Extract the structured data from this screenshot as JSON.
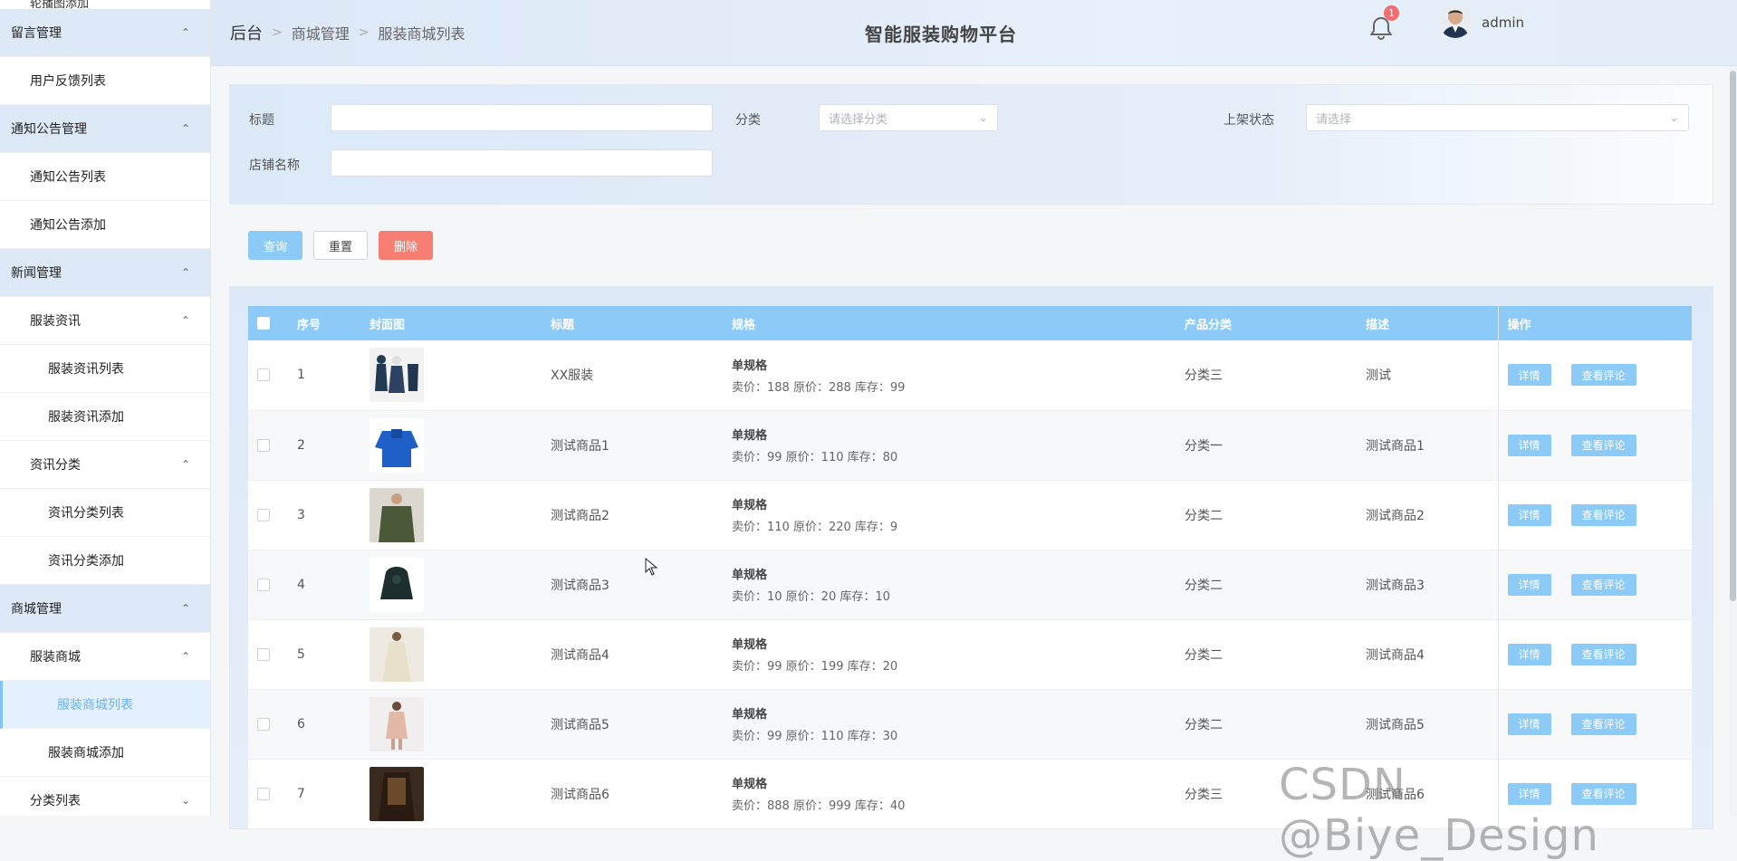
{
  "sidebar": {
    "clipped_item": "轮播图添加",
    "items": [
      {
        "label": "留言管理",
        "level": 0,
        "group": true
      },
      {
        "label": "用户反馈列表",
        "level": 1
      },
      {
        "label": "通知公告管理",
        "level": 0,
        "group": true
      },
      {
        "label": "通知公告列表",
        "level": 1
      },
      {
        "label": "通知公告添加",
        "level": 1
      },
      {
        "label": "新闻管理",
        "level": 0,
        "group": true
      },
      {
        "label": "服装资讯",
        "level": 1,
        "chevron": true
      },
      {
        "label": "服装资讯列表",
        "level": 2
      },
      {
        "label": "服装资讯添加",
        "level": 2
      },
      {
        "label": "资讯分类",
        "level": 1,
        "chevron": true
      },
      {
        "label": "资讯分类列表",
        "level": 2
      },
      {
        "label": "资讯分类添加",
        "level": 2
      },
      {
        "label": "商城管理",
        "level": 0,
        "group": true
      },
      {
        "label": "服装商城",
        "level": 1,
        "chevron": true
      },
      {
        "label": "服装商城列表",
        "level": 2,
        "active": true
      },
      {
        "label": "服装商城添加",
        "level": 2
      },
      {
        "label": "分类列表",
        "level": 1,
        "chevron": true
      }
    ]
  },
  "header": {
    "breadcrumb": [
      "后台",
      "商城管理",
      "服装商城列表"
    ],
    "app_title": "智能服装购物平台",
    "notification_count": "1",
    "username": "admin"
  },
  "filters": {
    "title_label": "标题",
    "title_value": "",
    "category_label": "分类",
    "category_placeholder": "请选择分类",
    "status_label": "上架状态",
    "status_placeholder": "请选择",
    "shop_label": "店铺名称",
    "shop_value": ""
  },
  "buttons": {
    "query": "查询",
    "reset": "重置",
    "delete": "删除"
  },
  "table": {
    "headers": [
      "序号",
      "封面图",
      "标题",
      "规格",
      "产品分类",
      "描述",
      "操作"
    ],
    "rows": [
      {
        "index": "1",
        "title": "XX服装",
        "spec_title": "单规格",
        "spec_detail": "卖价：188  原价：288  库存：99",
        "category": "分类三",
        "desc": "测试"
      },
      {
        "index": "2",
        "title": "测试商品1",
        "spec_title": "单规格",
        "spec_detail": "卖价：99  原价：110  库存：80",
        "category": "分类一",
        "desc": "测试商品1"
      },
      {
        "index": "3",
        "title": "测试商品2",
        "spec_title": "单规格",
        "spec_detail": "卖价：110  原价：220  库存：9",
        "category": "分类二",
        "desc": "测试商品2"
      },
      {
        "index": "4",
        "title": "测试商品3",
        "spec_title": "单规格",
        "spec_detail": "卖价：10  原价：20  库存：10",
        "category": "分类二",
        "desc": "测试商品3"
      },
      {
        "index": "5",
        "title": "测试商品4",
        "spec_title": "单规格",
        "spec_detail": "卖价：99  原价：199  库存：20",
        "category": "分类二",
        "desc": "测试商品4"
      },
      {
        "index": "6",
        "title": "测试商品5",
        "spec_title": "单规格",
        "spec_detail": "卖价：99  原价：110  库存：30",
        "category": "分类二",
        "desc": "测试商品5"
      },
      {
        "index": "7",
        "title": "测试商品6",
        "spec_title": "单规格",
        "spec_detail": "卖价：888  原价：999  库存：40",
        "category": "分类三",
        "desc": "测试商品6"
      }
    ],
    "action_detail": "详情",
    "action_review": "查看评论"
  },
  "watermark": "CSDN @Biye_Design",
  "colors": {
    "accent": "#8ccaf8",
    "danger": "#f77e73",
    "sidebar_group": "#dde9f6",
    "active_text": "#6eb3ee"
  }
}
